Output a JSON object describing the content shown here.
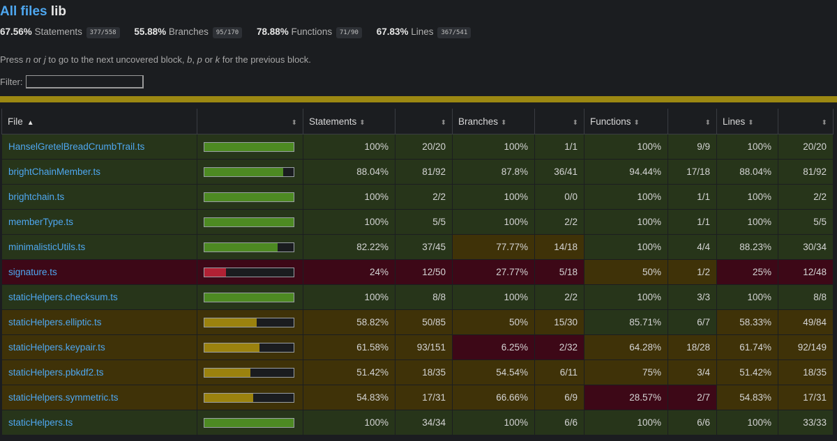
{
  "breadcrumb": {
    "root_label": "All files",
    "current": "lib"
  },
  "summary": [
    {
      "pct": "67.56%",
      "label": "Statements",
      "fraction": "377/558"
    },
    {
      "pct": "55.88%",
      "label": "Branches",
      "fraction": "95/170"
    },
    {
      "pct": "78.88%",
      "label": "Functions",
      "fraction": "71/90"
    },
    {
      "pct": "67.83%",
      "label": "Lines",
      "fraction": "367/541"
    }
  ],
  "hint": {
    "t1": "Press ",
    "k1": "n",
    "t2": " or ",
    "k2": "j",
    "t3": " to go to the next uncovered block, ",
    "k3": "b",
    "t4": ", ",
    "k4": "p",
    "t5": " or ",
    "k5": "k",
    "t6": " for the previous block."
  },
  "filter": {
    "label": "Filter:",
    "value": ""
  },
  "table": {
    "headers": {
      "file": "File",
      "statements": "Statements",
      "branches": "Branches",
      "functions": "Functions",
      "lines": "Lines"
    },
    "sort_glyph": "⬍",
    "asc_glyph": "▲",
    "rows": [
      {
        "file": "HanselGretelBreadCrumbTrail.ts",
        "bar_level": "high",
        "bar_fill": 1.0,
        "stmt_pct": "100%",
        "stmt_frac": "20/20",
        "stmt_level": "high",
        "br_pct": "100%",
        "br_frac": "1/1",
        "br_level": "high",
        "fn_pct": "100%",
        "fn_frac": "9/9",
        "fn_level": "high",
        "ln_pct": "100%",
        "ln_frac": "20/20",
        "ln_level": "high"
      },
      {
        "file": "brightChainMember.ts",
        "bar_level": "high",
        "bar_fill": 0.8804,
        "stmt_pct": "88.04%",
        "stmt_frac": "81/92",
        "stmt_level": "high",
        "br_pct": "87.8%",
        "br_frac": "36/41",
        "br_level": "high",
        "fn_pct": "94.44%",
        "fn_frac": "17/18",
        "fn_level": "high",
        "ln_pct": "88.04%",
        "ln_frac": "81/92",
        "ln_level": "high"
      },
      {
        "file": "brightchain.ts",
        "bar_level": "high",
        "bar_fill": 1.0,
        "stmt_pct": "100%",
        "stmt_frac": "2/2",
        "stmt_level": "high",
        "br_pct": "100%",
        "br_frac": "0/0",
        "br_level": "high",
        "fn_pct": "100%",
        "fn_frac": "1/1",
        "fn_level": "high",
        "ln_pct": "100%",
        "ln_frac": "2/2",
        "ln_level": "high"
      },
      {
        "file": "memberType.ts",
        "bar_level": "high",
        "bar_fill": 1.0,
        "stmt_pct": "100%",
        "stmt_frac": "5/5",
        "stmt_level": "high",
        "br_pct": "100%",
        "br_frac": "2/2",
        "br_level": "high",
        "fn_pct": "100%",
        "fn_frac": "1/1",
        "fn_level": "high",
        "ln_pct": "100%",
        "ln_frac": "5/5",
        "ln_level": "high"
      },
      {
        "file": "minimalisticUtils.ts",
        "bar_level": "high",
        "bar_fill": 0.8222,
        "stmt_pct": "82.22%",
        "stmt_frac": "37/45",
        "stmt_level": "high",
        "br_pct": "77.77%",
        "br_frac": "14/18",
        "br_level": "med",
        "fn_pct": "100%",
        "fn_frac": "4/4",
        "fn_level": "high",
        "ln_pct": "88.23%",
        "ln_frac": "30/34",
        "ln_level": "high"
      },
      {
        "file": "signature.ts",
        "bar_level": "low",
        "bar_fill": 0.24,
        "stmt_pct": "24%",
        "stmt_frac": "12/50",
        "stmt_level": "low",
        "br_pct": "27.77%",
        "br_frac": "5/18",
        "br_level": "low",
        "fn_pct": "50%",
        "fn_frac": "1/2",
        "fn_level": "med",
        "ln_pct": "25%",
        "ln_frac": "12/48",
        "ln_level": "low"
      },
      {
        "file": "staticHelpers.checksum.ts",
        "bar_level": "high",
        "bar_fill": 1.0,
        "stmt_pct": "100%",
        "stmt_frac": "8/8",
        "stmt_level": "high",
        "br_pct": "100%",
        "br_frac": "2/2",
        "br_level": "high",
        "fn_pct": "100%",
        "fn_frac": "3/3",
        "fn_level": "high",
        "ln_pct": "100%",
        "ln_frac": "8/8",
        "ln_level": "high"
      },
      {
        "file": "staticHelpers.elliptic.ts",
        "bar_level": "med",
        "bar_fill": 0.5882,
        "stmt_pct": "58.82%",
        "stmt_frac": "50/85",
        "stmt_level": "med",
        "br_pct": "50%",
        "br_frac": "15/30",
        "br_level": "med",
        "fn_pct": "85.71%",
        "fn_frac": "6/7",
        "fn_level": "high",
        "ln_pct": "58.33%",
        "ln_frac": "49/84",
        "ln_level": "med"
      },
      {
        "file": "staticHelpers.keypair.ts",
        "bar_level": "med",
        "bar_fill": 0.6158,
        "stmt_pct": "61.58%",
        "stmt_frac": "93/151",
        "stmt_level": "med",
        "br_pct": "6.25%",
        "br_frac": "2/32",
        "br_level": "low",
        "fn_pct": "64.28%",
        "fn_frac": "18/28",
        "fn_level": "med",
        "ln_pct": "61.74%",
        "ln_frac": "92/149",
        "ln_level": "med"
      },
      {
        "file": "staticHelpers.pbkdf2.ts",
        "bar_level": "med",
        "bar_fill": 0.5142,
        "stmt_pct": "51.42%",
        "stmt_frac": "18/35",
        "stmt_level": "med",
        "br_pct": "54.54%",
        "br_frac": "6/11",
        "br_level": "med",
        "fn_pct": "75%",
        "fn_frac": "3/4",
        "fn_level": "med",
        "ln_pct": "51.42%",
        "ln_frac": "18/35",
        "ln_level": "med"
      },
      {
        "file": "staticHelpers.symmetric.ts",
        "bar_level": "med",
        "bar_fill": 0.5483,
        "stmt_pct": "54.83%",
        "stmt_frac": "17/31",
        "stmt_level": "med",
        "br_pct": "66.66%",
        "br_frac": "6/9",
        "br_level": "med",
        "fn_pct": "28.57%",
        "fn_frac": "2/7",
        "fn_level": "low",
        "ln_pct": "54.83%",
        "ln_frac": "17/31",
        "ln_level": "med"
      },
      {
        "file": "staticHelpers.ts",
        "bar_level": "high",
        "bar_fill": 1.0,
        "stmt_pct": "100%",
        "stmt_frac": "34/34",
        "stmt_level": "high",
        "br_pct": "100%",
        "br_frac": "6/6",
        "br_level": "high",
        "fn_pct": "100%",
        "fn_frac": "6/6",
        "fn_level": "high",
        "ln_pct": "100%",
        "ln_frac": "33/33",
        "ln_level": "high"
      }
    ]
  }
}
